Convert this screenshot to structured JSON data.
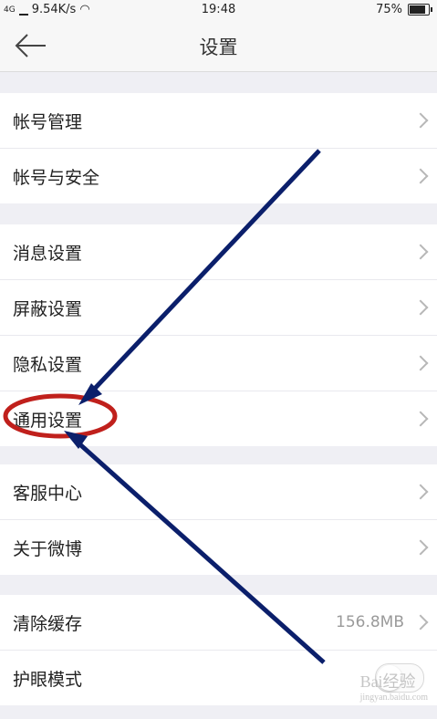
{
  "status_bar": {
    "network_type": "4G",
    "speed": "9.54K/s",
    "time": "19:48",
    "battery": "75%",
    "battery_level": 0.75
  },
  "header": {
    "title": "设置"
  },
  "groups": [
    {
      "items": [
        {
          "label": "帐号管理"
        },
        {
          "label": "帐号与安全"
        }
      ]
    },
    {
      "items": [
        {
          "label": "消息设置"
        },
        {
          "label": "屏蔽设置"
        },
        {
          "label": "隐私设置"
        },
        {
          "label": "通用设置"
        }
      ]
    },
    {
      "items": [
        {
          "label": "客服中心"
        },
        {
          "label": "关于微博"
        }
      ]
    },
    {
      "items": [
        {
          "label": "清除缓存",
          "value": "156.8MB"
        },
        {
          "label": "护眼模式",
          "toggle": false
        }
      ]
    }
  ],
  "watermark": {
    "text": "Bai经验",
    "subtext": "jingyan.baidu.com"
  },
  "colors": {
    "arrow": "#0b1f6b",
    "highlight_circle": "#c0201c"
  }
}
